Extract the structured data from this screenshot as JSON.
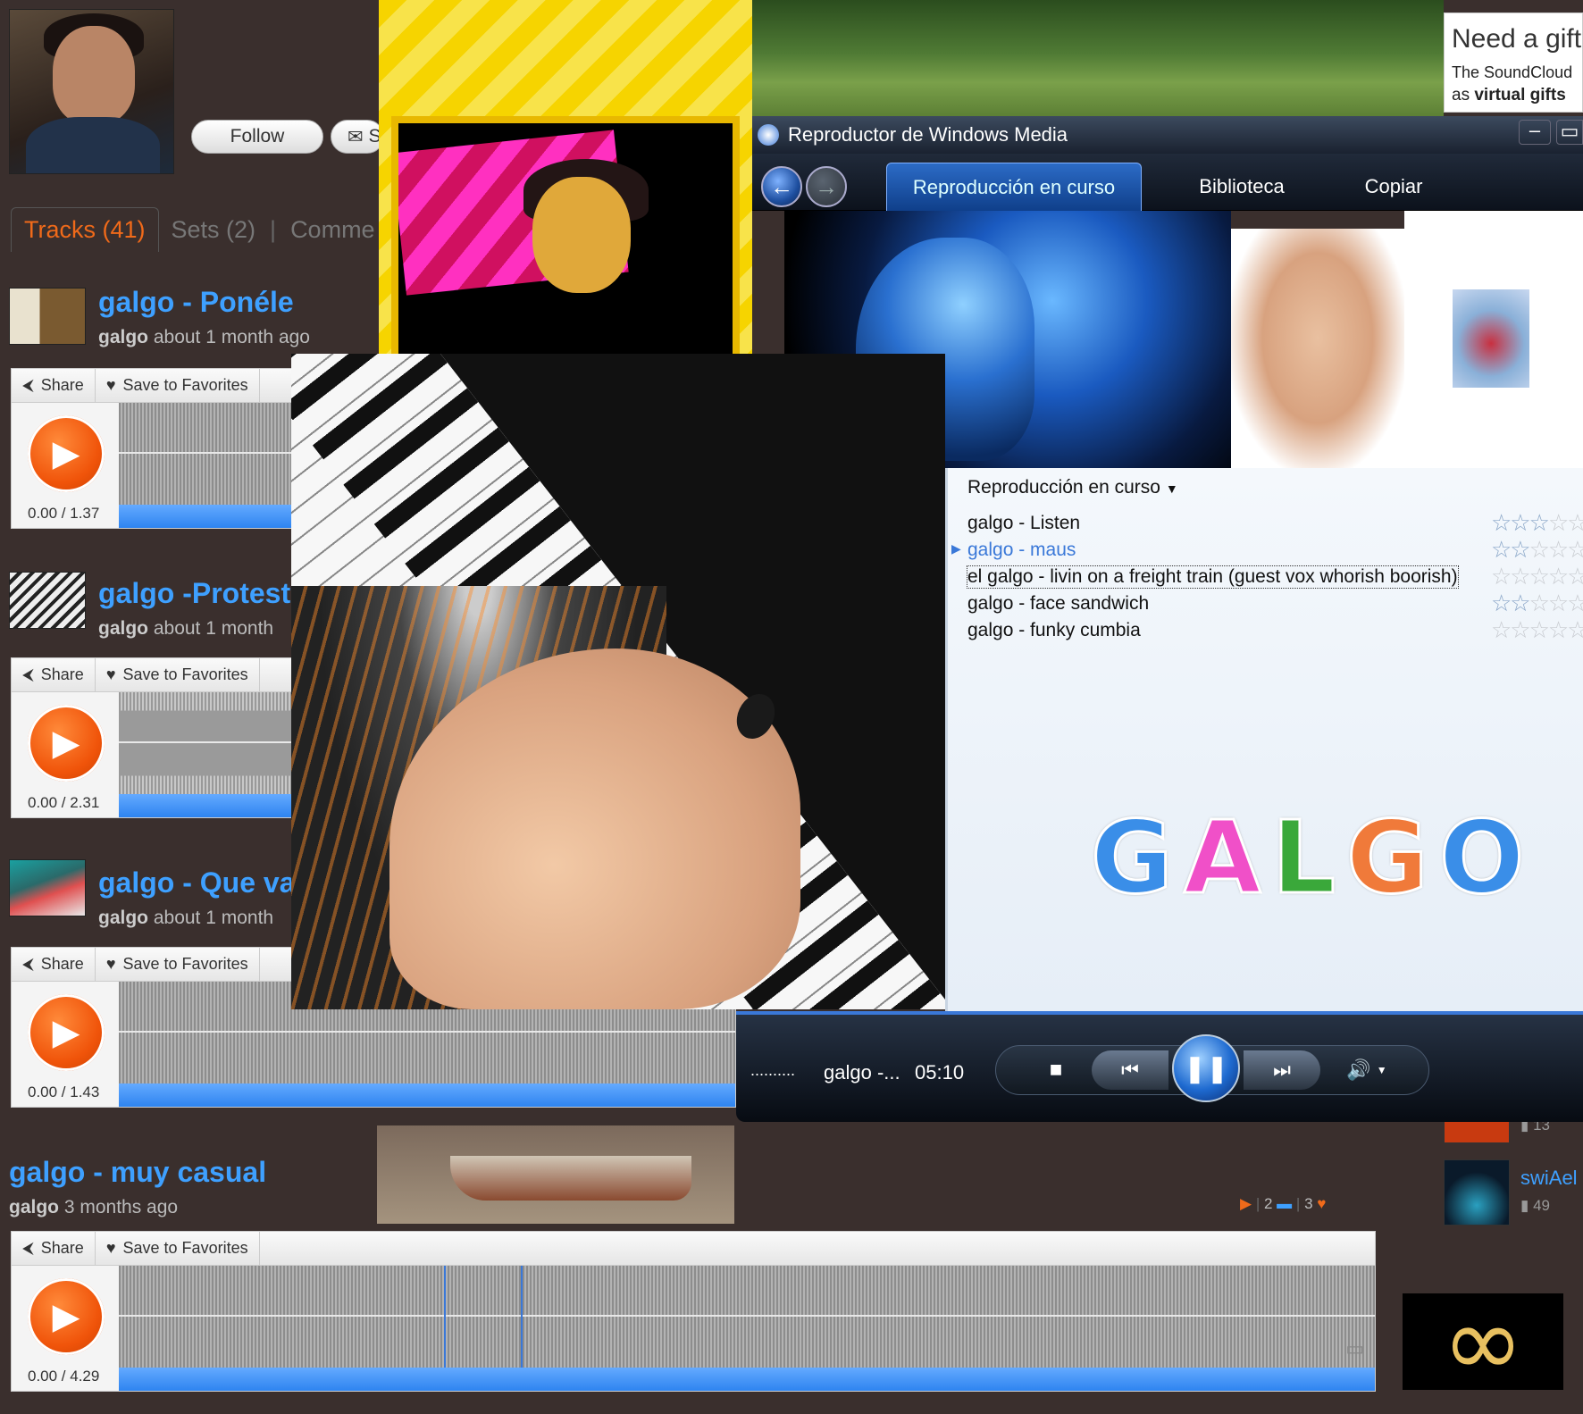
{
  "profile": {
    "follow_label": "Follow",
    "mail_label": "S"
  },
  "tabs": [
    {
      "label": "Tracks (41)"
    },
    {
      "label": "Sets (2)"
    },
    {
      "label": "Comme"
    }
  ],
  "tracks": [
    {
      "title": "galgo - Ponéle",
      "user": "galgo",
      "age": "about 1 month ago",
      "time": "0.00 / 1.37"
    },
    {
      "title": "galgo -Protest",
      "user": "galgo",
      "age": "about 1 month",
      "time": "0.00 / 2.31"
    },
    {
      "title": "galgo - Que va",
      "user": "galgo",
      "age": "about 1 month",
      "time": "0.00 / 1.43"
    },
    {
      "title": "galgo - muy casual",
      "user": "galgo",
      "age": "3 months ago",
      "time": "0.00 / 4.29",
      "stats": {
        "plays": "",
        "comments": "2",
        "favorites": "3"
      }
    }
  ],
  "actions": {
    "share": "Share",
    "favorite": "Save to Favorites"
  },
  "gift": {
    "title": "Need a gift",
    "line1": "The SoundCloud",
    "line2_prefix": "as",
    "line2_bold": "virtual gifts"
  },
  "wmp": {
    "title": "Reproductor de Windows Media",
    "tabs": [
      "Reproducción en curso",
      "Biblioteca",
      "Copiar"
    ],
    "playlist_header": "Reproducción en curso",
    "playlist": [
      {
        "name": "galgo - Listen",
        "rating": 3,
        "state": "normal"
      },
      {
        "name": "galgo - maus",
        "rating": 2,
        "state": "current"
      },
      {
        "name": "el galgo - livin on a freight train (guest vox whorish boorish)",
        "rating": 0,
        "state": "selected"
      },
      {
        "name": "galgo - face sandwich",
        "rating": 2,
        "state": "normal"
      },
      {
        "name": "galgo - funky cumbia",
        "rating": 0,
        "state": "normal"
      }
    ],
    "logo_letters": [
      "G",
      "A",
      "L",
      "G",
      "O"
    ],
    "now_playing_dots": "..........",
    "now_playing": "galgo -...",
    "elapsed": "05:10"
  },
  "sidebar": {
    "item1": "swiAel",
    "item1_count": "49",
    "item0_count": "13"
  },
  "colors": {
    "accent_orange": "#f06a1a",
    "link_blue": "#3ea0ff",
    "wmp_blue": "#3a78d8",
    "logo": [
      "#3a8ee8",
      "#f050c8",
      "#3aa83a",
      "#f07a3a",
      "#3a8ee8"
    ]
  }
}
